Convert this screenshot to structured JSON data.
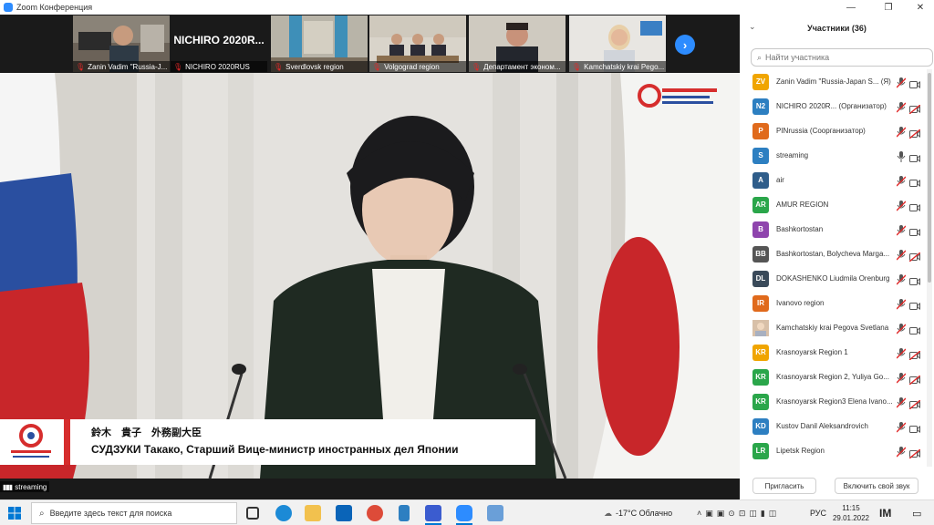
{
  "window": {
    "title": "Zoom Конференция",
    "minimize": "—",
    "maximize": "❐",
    "close": "✕"
  },
  "thumbnails": [
    {
      "label": "Zanin Vadim \"Russia-J...",
      "big_name": ""
    },
    {
      "label": "NICHIRO 2020RUS",
      "big_name": "NICHIRO 2020R..."
    },
    {
      "label": "Sverdlovsk region",
      "big_name": ""
    },
    {
      "label": "Volgograd region",
      "big_name": ""
    },
    {
      "label": "Департамент эконом...",
      "big_name": ""
    },
    {
      "label": "Kamchatskiy krai Pego...",
      "big_name": ""
    }
  ],
  "next_page_icon": "chevron-right-icon",
  "caption": {
    "line1": "鈴木　貴子　外務副大臣",
    "line2": "СУДЗУКИ Такако, Старший Вице-министр иностранных дел Японии"
  },
  "stream_label": "streaming",
  "participants": {
    "title": "Участники (36)",
    "search_placeholder": "Найти участника",
    "items": [
      {
        "initials": "ZV",
        "name": "Zanin Vadim \"Russia-Japan S... (Я)",
        "color": "#f0a500",
        "mic": "muted",
        "cam": "on"
      },
      {
        "initials": "N2",
        "name": "NICHIRO 2020R...   (Организатор)",
        "color": "#2d7fc1",
        "mic": "muted",
        "cam": "off"
      },
      {
        "initials": "P",
        "name": "PINrussia (Соорганизатор)",
        "color": "#e06a1c",
        "mic": "muted",
        "cam": "off"
      },
      {
        "initials": "S",
        "name": "streaming",
        "color": "#2d7fc1",
        "mic": "on",
        "cam": "on"
      },
      {
        "initials": "A",
        "name": "air",
        "color": "#2f5d8a",
        "mic": "muted",
        "cam": "on"
      },
      {
        "initials": "AR",
        "name": "AMUR REGION",
        "color": "#2aa64a",
        "mic": "muted",
        "cam": "on"
      },
      {
        "initials": "B",
        "name": "Bashkortostan",
        "color": "#8e44ad",
        "mic": "muted",
        "cam": "on"
      },
      {
        "initials": "BB",
        "name": "Bashkortostan, Bolycheva Marga...",
        "color": "#555555",
        "mic": "muted",
        "cam": "off"
      },
      {
        "initials": "DL",
        "name": "DOKASHENKO Liudmila Orenburg",
        "color": "#3a4a5a",
        "mic": "muted",
        "cam": "on"
      },
      {
        "initials": "IR",
        "name": "Ivanovo region",
        "color": "#e06a1c",
        "mic": "muted",
        "cam": "on"
      },
      {
        "initials": "",
        "name": "Kamchatskiy krai Pegova Svetlana",
        "color": "#c9a98a",
        "mic": "muted",
        "cam": "on"
      },
      {
        "initials": "KR",
        "name": "Krasnoyarsk Region 1",
        "color": "#f0a500",
        "mic": "muted",
        "cam": "off"
      },
      {
        "initials": "KR",
        "name": "Krasnoyarsk Region 2,  Yuliya Go...",
        "color": "#2aa64a",
        "mic": "muted",
        "cam": "off"
      },
      {
        "initials": "KR",
        "name": "Krasnoyarsk Region3 Elena Ivano...",
        "color": "#2aa64a",
        "mic": "muted",
        "cam": "off"
      },
      {
        "initials": "KD",
        "name": "Kustov Danil Aleksandrovich",
        "color": "#2d7fc1",
        "mic": "muted",
        "cam": "on"
      },
      {
        "initials": "LR",
        "name": "Lipetsk Region",
        "color": "#2aa64a",
        "mic": "muted",
        "cam": "off"
      }
    ],
    "invite_label": "Пригласить",
    "unmute_label": "Включить свой звук"
  },
  "taskbar": {
    "search_placeholder": "Введите здесь текст для поиска",
    "weather": "-17°C  Облачно",
    "language": "РУС",
    "time": "11:15",
    "date": "29.01.2022"
  },
  "colors": {
    "accent": "#2d8cff",
    "muted": "#e02828"
  }
}
